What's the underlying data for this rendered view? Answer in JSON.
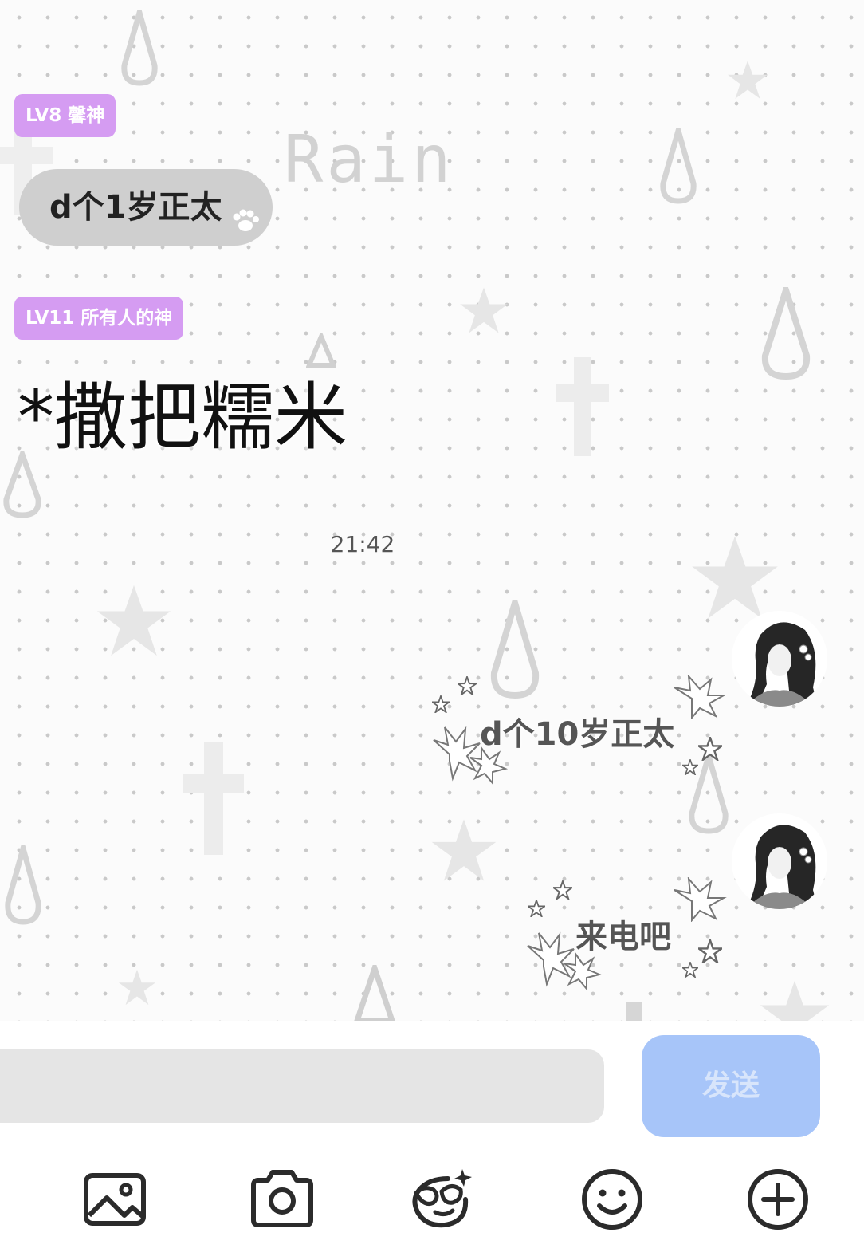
{
  "background": {
    "watermark_text": "Rain"
  },
  "messages": [
    {
      "direction": "incoming",
      "level_badge": "LV8 馨神",
      "text": "d个1岁正太"
    },
    {
      "direction": "incoming",
      "level_badge": "LV11 所有人的神",
      "text": "*撒把糯米"
    }
  ],
  "timestamp": "21:42",
  "outgoing": [
    {
      "text": "d个10岁正太"
    },
    {
      "text": "来电吧"
    }
  ],
  "composer": {
    "input_value": "",
    "send_label": "发送"
  },
  "toolbar": {
    "icons": [
      "image-icon",
      "camera-icon",
      "sticker-mask-icon",
      "emoji-icon",
      "plus-icon"
    ]
  },
  "colors": {
    "level_badge": "#d59cf2",
    "incoming_bubble": "#cfcfcf",
    "send_button": "#a7c5f9",
    "input_field": "#e5e5e5"
  }
}
